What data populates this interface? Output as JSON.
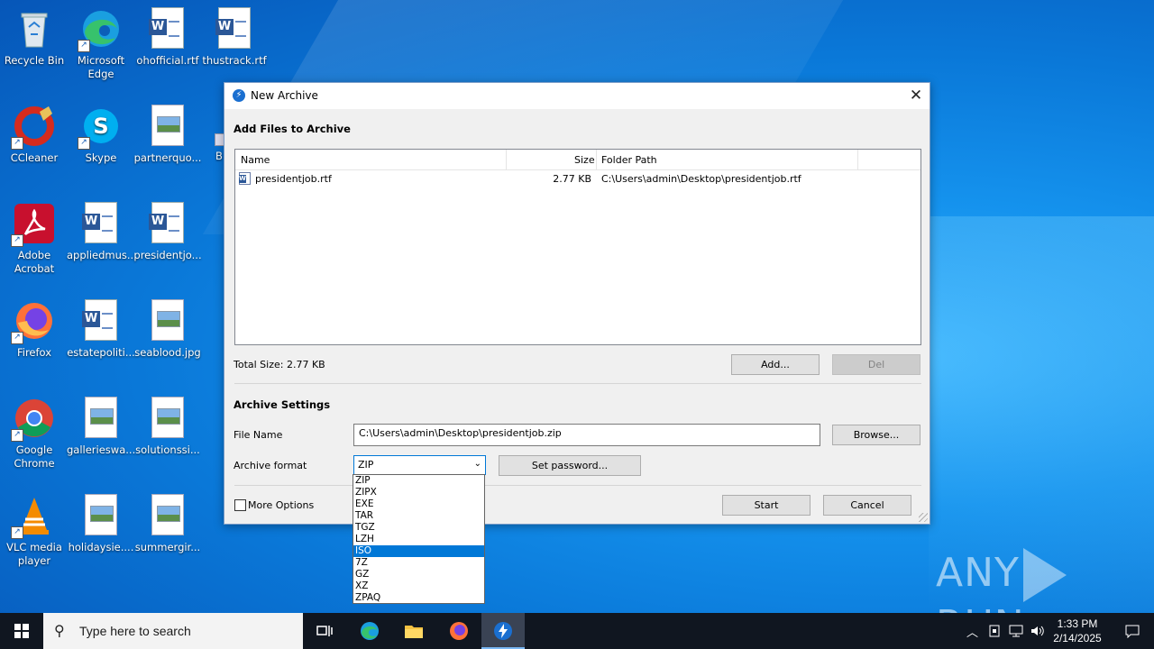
{
  "desktop": {
    "icons": [
      {
        "label": "Recycle Bin"
      },
      {
        "label": "Microsoft Edge"
      },
      {
        "label": "ohofficial.rtf"
      },
      {
        "label": "thustrack.rtf"
      },
      {
        "label": "CCleaner"
      },
      {
        "label": "Skype"
      },
      {
        "label": "partnerquo..."
      },
      {
        "label": "B"
      },
      {
        "label": "Adobe Acrobat"
      },
      {
        "label": "appliedmus..."
      },
      {
        "label": "presidentjo..."
      },
      {
        "label": "Firefox"
      },
      {
        "label": "estatepoliti..."
      },
      {
        "label": "seablood.jpg"
      },
      {
        "label": "Google Chrome"
      },
      {
        "label": "gallerieswa..."
      },
      {
        "label": "solutionssi..."
      },
      {
        "label": "VLC media player"
      },
      {
        "label": "holidaysie...."
      },
      {
        "label": "summergir..."
      }
    ]
  },
  "dialog": {
    "title": "New Archive",
    "add_files_heading": "Add Files to Archive",
    "columns": {
      "name": "Name",
      "size": "Size",
      "folder": "Folder Path"
    },
    "files": [
      {
        "name": "presidentjob.rtf",
        "size": "2.77 KB",
        "path": "C:\\Users\\admin\\Desktop\\presidentjob.rtf"
      }
    ],
    "total_size": "Total Size: 2.77 KB",
    "add_button": "Add...",
    "del_button": "Del",
    "settings_heading": "Archive Settings",
    "file_name_label": "File Name",
    "file_name_value": "C:\\Users\\admin\\Desktop\\presidentjob.zip",
    "browse_button": "Browse...",
    "archive_format_label": "Archive format",
    "archive_format_value": "ZIP",
    "set_password_button": "Set password...",
    "more_options_label": "More Options",
    "start_button": "Start",
    "cancel_button": "Cancel",
    "format_options": [
      "ZIP",
      "ZIPX",
      "EXE",
      "TAR",
      "TGZ",
      "LZH",
      "ISO",
      "7Z",
      "GZ",
      "XZ",
      "ZPAQ"
    ],
    "highlighted_option": "ISO"
  },
  "watermark": {
    "left": "ANY",
    "right": "RUN"
  },
  "taskbar": {
    "search_placeholder": "Type here to search",
    "time": "1:33 PM",
    "date": "2/14/2025"
  },
  "colors": {
    "accent": "#0078d7",
    "taskbar": "#101620"
  }
}
